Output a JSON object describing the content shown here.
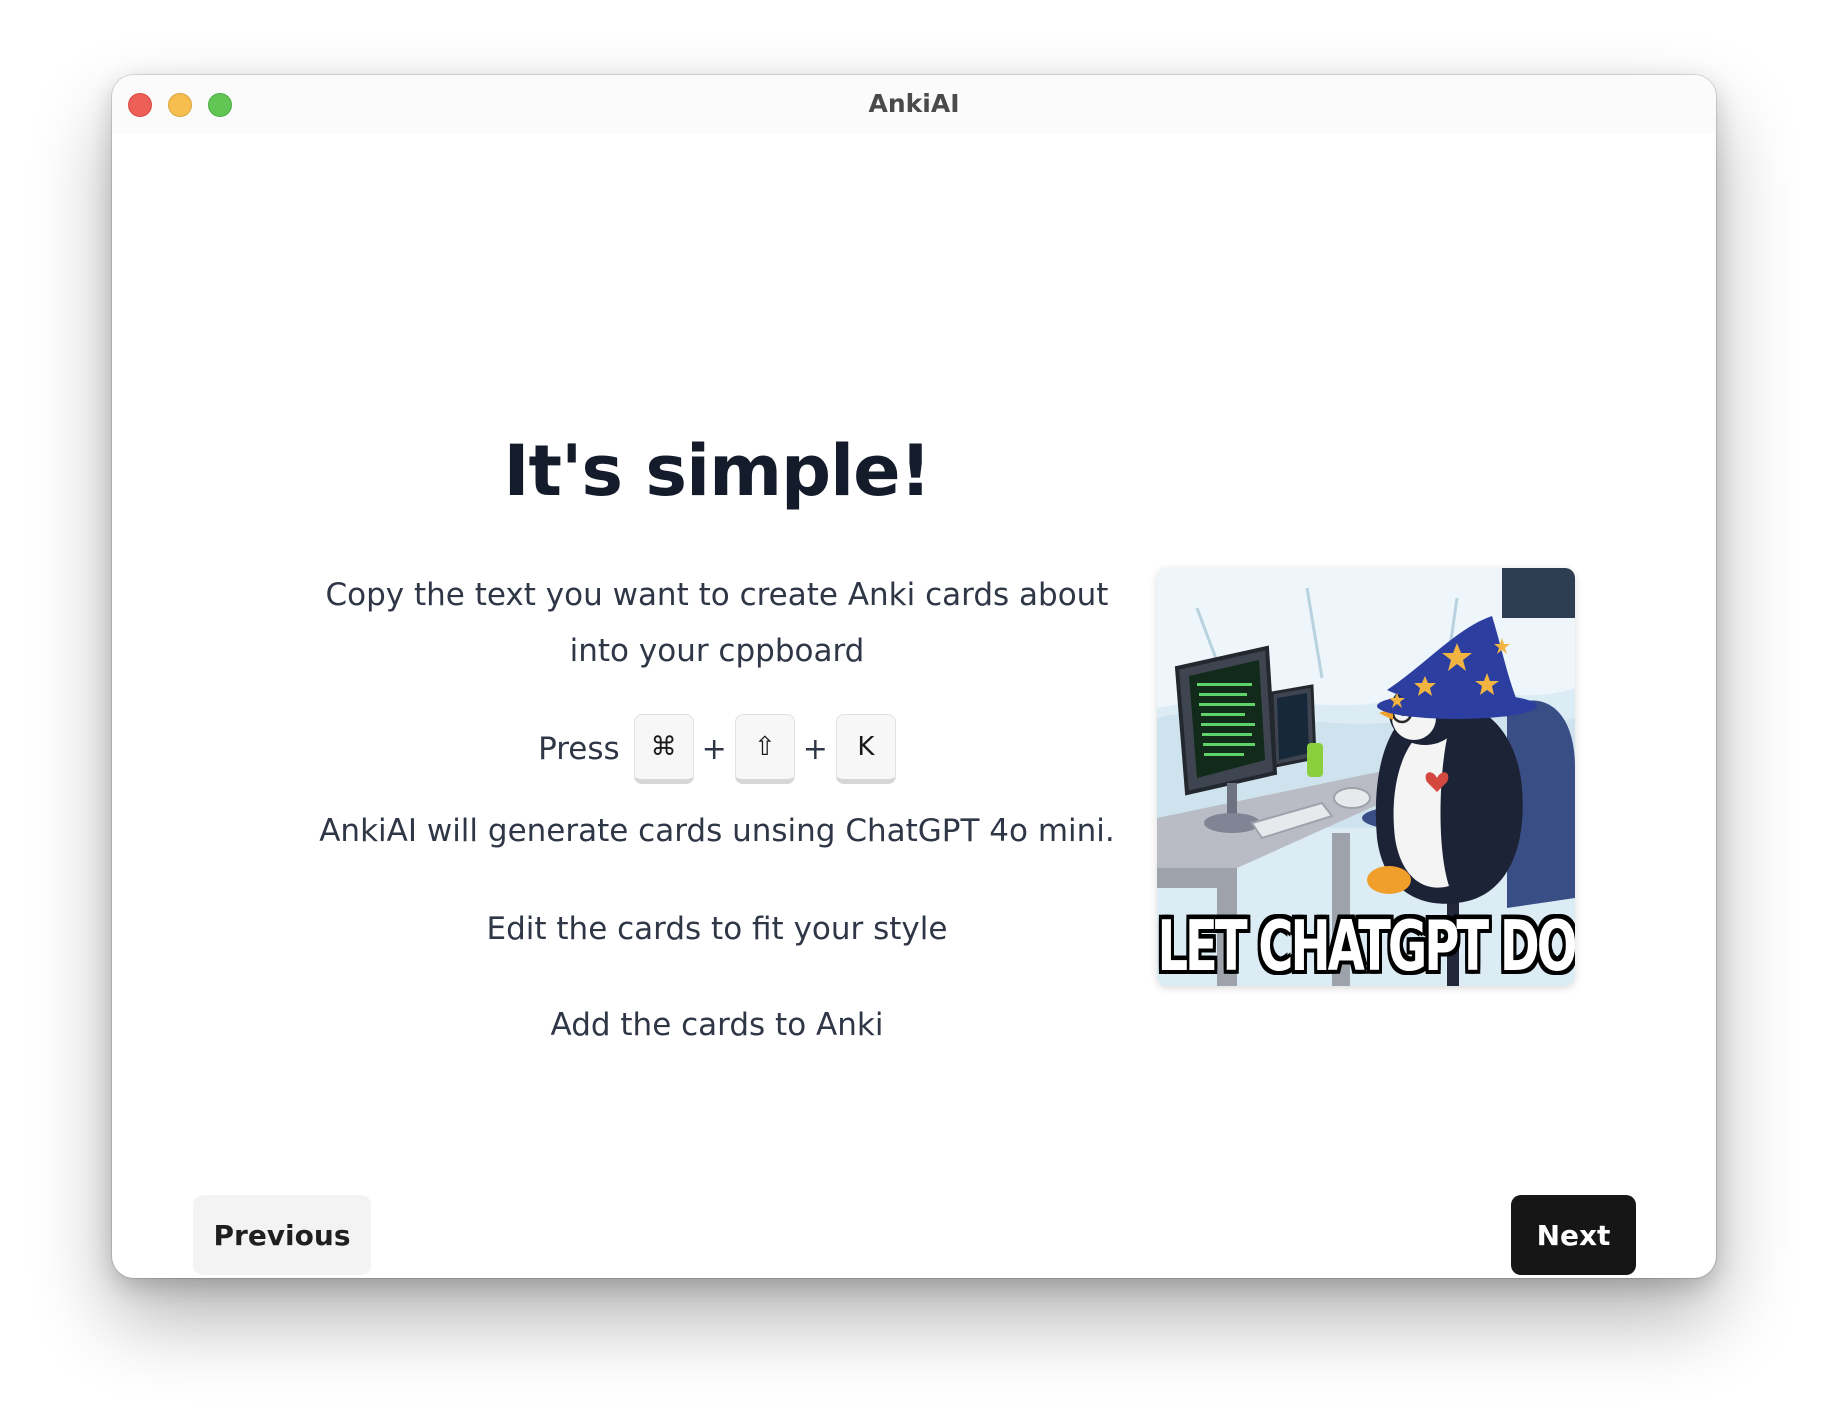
{
  "window": {
    "title": "AnkiAI"
  },
  "main": {
    "heading": "It's simple!",
    "steps": {
      "copy": "Copy the text you want to create Anki cards about into your cppboard",
      "press_label": "Press",
      "keys": [
        "⌘",
        "⇧",
        "K"
      ],
      "plus": "+",
      "generate": "AnkiAI will generate cards unsing ChatGPT 4o mini.",
      "edit": "Edit the cards to fit your style",
      "add": "Add the cards to Anki"
    },
    "image": {
      "caption": "LET CHATGPT DO IT"
    }
  },
  "footer": {
    "previous_label": "Previous",
    "next_label": "Next"
  },
  "colors": {
    "next_button": "#161616",
    "previous_button": "#f3f3f3",
    "heading": "#141b2b"
  }
}
